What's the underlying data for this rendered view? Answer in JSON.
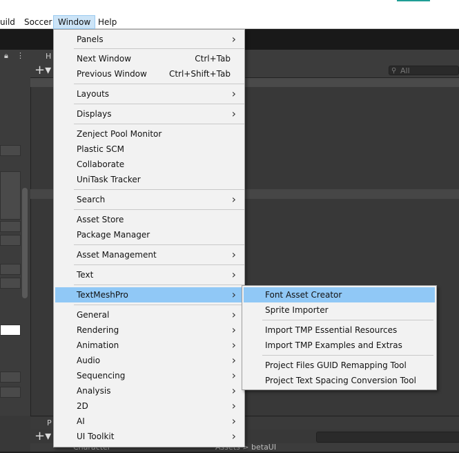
{
  "menubar": {
    "items": [
      {
        "label": "uild"
      },
      {
        "label": "Soccer"
      },
      {
        "label": "Window"
      },
      {
        "label": "Help"
      }
    ],
    "active_index": 2
  },
  "hierarchy": {
    "tab_label": "H",
    "search_placeholder": "All"
  },
  "project": {
    "tab_label": "P",
    "path_item": "Character",
    "breadcrumb": "Assets > betaUI"
  },
  "window_menu": {
    "items": [
      {
        "label": "Panels",
        "submenu": true
      },
      {
        "label": "Next Window",
        "shortcut": "Ctrl+Tab"
      },
      {
        "label": "Previous Window",
        "shortcut": "Ctrl+Shift+Tab"
      },
      {
        "label": "Layouts",
        "submenu": true
      },
      {
        "label": "Displays",
        "submenu": true
      },
      {
        "label": "Zenject Pool Monitor"
      },
      {
        "label": "Plastic SCM"
      },
      {
        "label": "Collaborate"
      },
      {
        "label": "UniTask Tracker"
      },
      {
        "label": "Search",
        "submenu": true
      },
      {
        "label": "Asset Store"
      },
      {
        "label": "Package Manager"
      },
      {
        "label": "Asset Management",
        "submenu": true
      },
      {
        "label": "Text",
        "submenu": true
      },
      {
        "label": "TextMeshPro",
        "submenu": true,
        "highlighted": true
      },
      {
        "label": "General",
        "submenu": true
      },
      {
        "label": "Rendering",
        "submenu": true
      },
      {
        "label": "Animation",
        "submenu": true
      },
      {
        "label": "Audio",
        "submenu": true
      },
      {
        "label": "Sequencing",
        "submenu": true
      },
      {
        "label": "Analysis",
        "submenu": true
      },
      {
        "label": "2D",
        "submenu": true
      },
      {
        "label": "AI",
        "submenu": true
      },
      {
        "label": "UI Toolkit",
        "submenu": true
      }
    ]
  },
  "tmp_submenu": {
    "items": [
      {
        "label": "Font Asset Creator",
        "highlighted": true
      },
      {
        "label": "Sprite Importer"
      },
      {
        "label": "Import TMP Essential Resources"
      },
      {
        "label": "Import TMP Examples and Extras"
      },
      {
        "label": "Project Files GUID Remapping Tool"
      },
      {
        "label": "Project Text Spacing Conversion Tool"
      }
    ]
  },
  "icons": {
    "submenu_arrow": "chevron-right-icon",
    "search": "search-icon",
    "add": "plus-icon",
    "play": "play-icon",
    "lock": "lock-icon"
  },
  "colors": {
    "menu_bg": "#f2f2f2",
    "highlight": "#90c8f6",
    "menubar_active": "#cce4f7",
    "editor_bg": "#383838"
  }
}
